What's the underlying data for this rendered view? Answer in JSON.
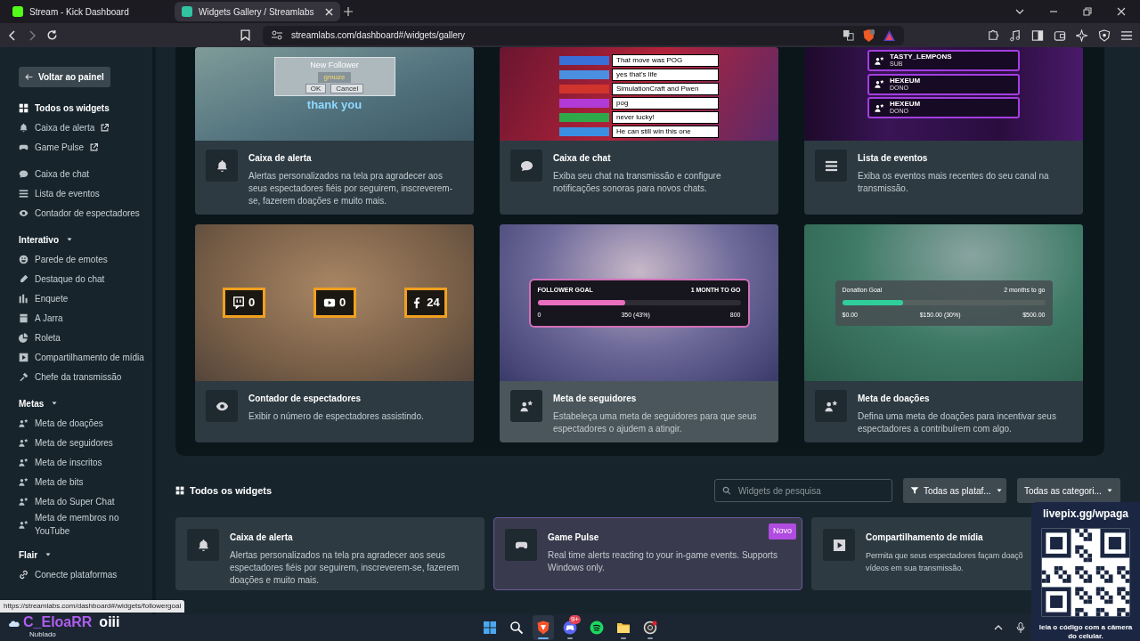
{
  "browser": {
    "tabs": [
      {
        "title": "Stream - Kick Dashboard",
        "selected": false
      },
      {
        "title": "Widgets Gallery / Streamlabs",
        "selected": true
      }
    ],
    "url": "streamlabs.com/dashboard#/widgets/gallery"
  },
  "sidebar": {
    "back_button": "Voltar ao painel",
    "sections": [
      {
        "items": [
          {
            "label": "Todos os widgets",
            "selected": true,
            "external": false
          },
          {
            "label": "Caixa de alerta",
            "selected": false,
            "external": true
          },
          {
            "label": "Game Pulse",
            "selected": false,
            "external": true
          }
        ]
      },
      {
        "items": [
          {
            "label": "Caixa de chat",
            "selected": false,
            "external": false
          },
          {
            "label": "Lista de eventos",
            "selected": false,
            "external": false
          },
          {
            "label": "Contador de espectadores",
            "selected": false,
            "external": false
          }
        ]
      },
      {
        "heading": "Interativo",
        "expanded": true,
        "items": [
          {
            "label": "Parede de emotes",
            "selected": false,
            "external": false
          },
          {
            "label": "Destaque do chat",
            "selected": false,
            "external": false
          },
          {
            "label": "Enquete",
            "selected": false,
            "external": false
          },
          {
            "label": "A Jarra",
            "selected": false,
            "external": false
          },
          {
            "label": "Roleta",
            "selected": false,
            "external": false
          },
          {
            "label": "Compartilhamento de mídia",
            "selected": false,
            "external": false
          },
          {
            "label": "Chefe da transmissão",
            "selected": false,
            "external": false
          }
        ]
      },
      {
        "heading": "Metas",
        "expanded": true,
        "items": [
          {
            "label": "Meta de doações",
            "selected": false,
            "external": false
          },
          {
            "label": "Meta de seguidores",
            "selected": false,
            "external": false
          },
          {
            "label": "Meta de inscritos",
            "selected": false,
            "external": false
          },
          {
            "label": "Meta de bits",
            "selected": false,
            "external": false
          },
          {
            "label": "Meta do Super Chat",
            "selected": false,
            "external": false
          },
          {
            "label": "Meta de membros no YouTube",
            "selected": false,
            "external": false
          }
        ]
      },
      {
        "heading": "Flair",
        "expanded": true,
        "items": [
          {
            "label": "Conecte plataformas",
            "selected": false,
            "external": false
          }
        ]
      }
    ]
  },
  "featured": [
    {
      "title": "Caixa de alerta",
      "description": "Alertas personalizados na tela pra agradecer aos seus espectadores fiéis por seguirem, inscreverem-se, fazerem doações e muito mais.",
      "highlighted": false,
      "preview": {
        "kind": "alert",
        "title": "New Follower",
        "name": "gmuze",
        "buttons": [
          "OK",
          "Cancel"
        ],
        "caption": "thank you"
      }
    },
    {
      "title": "Caixa de chat",
      "description": "Exiba seu chat na transmissão e configure notificações sonoras para novos chats.",
      "highlighted": false,
      "preview": {
        "kind": "chat",
        "messages": [
          {
            "text": "That move was POG",
            "color": "#3b6fd8"
          },
          {
            "text": "yes that's life",
            "color": "#4a8fe0"
          },
          {
            "text": "SimulationCraft and Pwen",
            "color": "#d0342c"
          },
          {
            "text": "pog",
            "color": "#b23ad6"
          },
          {
            "text": "never lucky!",
            "color": "#2fa84a"
          },
          {
            "text": "He can still win this one",
            "color": "#3b8fe0"
          }
        ]
      }
    },
    {
      "title": "Lista de eventos",
      "description": "Exiba os eventos mais recentes do seu canal na transmissão.",
      "highlighted": false,
      "preview": {
        "kind": "events",
        "items": [
          {
            "name": "TASTY_LEMPONS",
            "tag": "SUB"
          },
          {
            "name": "HEXEUM",
            "tag": "DONO"
          },
          {
            "name": "HEXEUM",
            "tag": "DONO"
          }
        ]
      }
    },
    {
      "title": "Contador de espectadores",
      "description": "Exibir o número de espectadores assistindo.",
      "highlighted": false,
      "preview": {
        "kind": "counter",
        "counts": [
          "0",
          "0",
          "24"
        ]
      }
    },
    {
      "title": "Meta de seguidores",
      "description": "Estabeleça uma meta de seguidores para que seus espectadores o ajudem a atingir.",
      "highlighted": true,
      "preview": {
        "kind": "follower_goal",
        "title": "FOLLOWER GOAL",
        "remaining": "1 MONTH TO GO",
        "start": "0",
        "current": "350 (43%)",
        "end": "800",
        "level": 0.43,
        "color": "#e86fc0"
      }
    },
    {
      "title": "Meta de doações",
      "description": "Defina uma meta de doações para incentivar seus espectadores a contribuírem com algo.",
      "highlighted": false,
      "preview": {
        "kind": "donation_goal",
        "title": "Donation Goal",
        "remaining": "2 months to go",
        "start": "$0.00",
        "current": "$150.00 (30%)",
        "end": "$500.00",
        "level": 0.3,
        "color": "#2fcf9a"
      }
    }
  ],
  "all_widgets": {
    "title": "Todos os widgets",
    "search": {
      "placeholder": "Widgets de pesquisa"
    },
    "filters": [
      "Todas as plataf...",
      "Todas as categori..."
    ],
    "cards": [
      {
        "title": "Caixa de alerta",
        "description": "Alertas personalizados na tela pra agradecer aos seus espectadores fiéis por seguirem, inscreverem-se, fazerem doações e muito mais.",
        "highlighted": false
      },
      {
        "title": "Game Pulse",
        "description": "Real time alerts reacting to your in-game events. Supports Windows only.",
        "highlighted": true,
        "badge": "Novo"
      },
      {
        "title": "Compartilhamento de mídia",
        "description": "Permita que seus espectadores façam doaçõ vídeos em sua transmissão.",
        "highlighted": false
      }
    ]
  },
  "status_url": "https://streamlabs.com/dashboard#/widgets/followergoal",
  "taskbar": {
    "weather": "Nublado",
    "apps": [
      {
        "selected": false,
        "running": false
      },
      {
        "selected": false,
        "running": false
      },
      {
        "selected": true,
        "running": true
      },
      {
        "selected": false,
        "running": true,
        "badge": "9+"
      },
      {
        "selected": false,
        "running": false
      },
      {
        "selected": false,
        "running": true
      },
      {
        "selected": false,
        "running": true
      }
    ]
  },
  "stream_chat": {
    "user": "C_EloaRR",
    "message": "oiii"
  },
  "qr_overlay": {
    "url": "livepix.gg/wpaga",
    "caption": "leia o código com a câmera do celular."
  }
}
